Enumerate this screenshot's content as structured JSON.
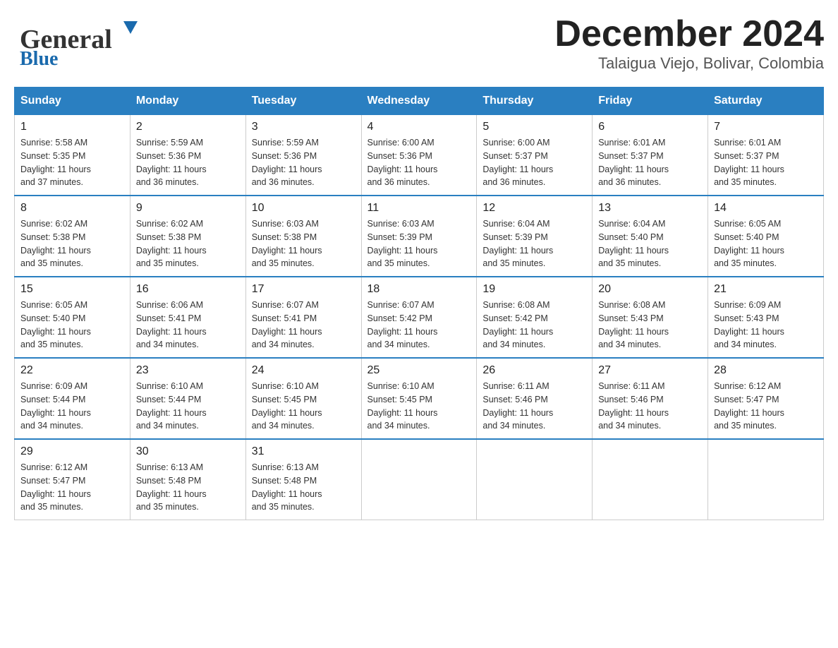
{
  "header": {
    "logo_general": "General",
    "logo_blue": "Blue",
    "month_title": "December 2024",
    "location": "Talaigua Viejo, Bolivar, Colombia"
  },
  "days_of_week": [
    "Sunday",
    "Monday",
    "Tuesday",
    "Wednesday",
    "Thursday",
    "Friday",
    "Saturday"
  ],
  "weeks": [
    [
      {
        "day": "1",
        "sunrise": "5:58 AM",
        "sunset": "5:35 PM",
        "daylight": "11 hours and 37 minutes."
      },
      {
        "day": "2",
        "sunrise": "5:59 AM",
        "sunset": "5:36 PM",
        "daylight": "11 hours and 36 minutes."
      },
      {
        "day": "3",
        "sunrise": "5:59 AM",
        "sunset": "5:36 PM",
        "daylight": "11 hours and 36 minutes."
      },
      {
        "day": "4",
        "sunrise": "6:00 AM",
        "sunset": "5:36 PM",
        "daylight": "11 hours and 36 minutes."
      },
      {
        "day": "5",
        "sunrise": "6:00 AM",
        "sunset": "5:37 PM",
        "daylight": "11 hours and 36 minutes."
      },
      {
        "day": "6",
        "sunrise": "6:01 AM",
        "sunset": "5:37 PM",
        "daylight": "11 hours and 36 minutes."
      },
      {
        "day": "7",
        "sunrise": "6:01 AM",
        "sunset": "5:37 PM",
        "daylight": "11 hours and 35 minutes."
      }
    ],
    [
      {
        "day": "8",
        "sunrise": "6:02 AM",
        "sunset": "5:38 PM",
        "daylight": "11 hours and 35 minutes."
      },
      {
        "day": "9",
        "sunrise": "6:02 AM",
        "sunset": "5:38 PM",
        "daylight": "11 hours and 35 minutes."
      },
      {
        "day": "10",
        "sunrise": "6:03 AM",
        "sunset": "5:38 PM",
        "daylight": "11 hours and 35 minutes."
      },
      {
        "day": "11",
        "sunrise": "6:03 AM",
        "sunset": "5:39 PM",
        "daylight": "11 hours and 35 minutes."
      },
      {
        "day": "12",
        "sunrise": "6:04 AM",
        "sunset": "5:39 PM",
        "daylight": "11 hours and 35 minutes."
      },
      {
        "day": "13",
        "sunrise": "6:04 AM",
        "sunset": "5:40 PM",
        "daylight": "11 hours and 35 minutes."
      },
      {
        "day": "14",
        "sunrise": "6:05 AM",
        "sunset": "5:40 PM",
        "daylight": "11 hours and 35 minutes."
      }
    ],
    [
      {
        "day": "15",
        "sunrise": "6:05 AM",
        "sunset": "5:40 PM",
        "daylight": "11 hours and 35 minutes."
      },
      {
        "day": "16",
        "sunrise": "6:06 AM",
        "sunset": "5:41 PM",
        "daylight": "11 hours and 34 minutes."
      },
      {
        "day": "17",
        "sunrise": "6:07 AM",
        "sunset": "5:41 PM",
        "daylight": "11 hours and 34 minutes."
      },
      {
        "day": "18",
        "sunrise": "6:07 AM",
        "sunset": "5:42 PM",
        "daylight": "11 hours and 34 minutes."
      },
      {
        "day": "19",
        "sunrise": "6:08 AM",
        "sunset": "5:42 PM",
        "daylight": "11 hours and 34 minutes."
      },
      {
        "day": "20",
        "sunrise": "6:08 AM",
        "sunset": "5:43 PM",
        "daylight": "11 hours and 34 minutes."
      },
      {
        "day": "21",
        "sunrise": "6:09 AM",
        "sunset": "5:43 PM",
        "daylight": "11 hours and 34 minutes."
      }
    ],
    [
      {
        "day": "22",
        "sunrise": "6:09 AM",
        "sunset": "5:44 PM",
        "daylight": "11 hours and 34 minutes."
      },
      {
        "day": "23",
        "sunrise": "6:10 AM",
        "sunset": "5:44 PM",
        "daylight": "11 hours and 34 minutes."
      },
      {
        "day": "24",
        "sunrise": "6:10 AM",
        "sunset": "5:45 PM",
        "daylight": "11 hours and 34 minutes."
      },
      {
        "day": "25",
        "sunrise": "6:10 AM",
        "sunset": "5:45 PM",
        "daylight": "11 hours and 34 minutes."
      },
      {
        "day": "26",
        "sunrise": "6:11 AM",
        "sunset": "5:46 PM",
        "daylight": "11 hours and 34 minutes."
      },
      {
        "day": "27",
        "sunrise": "6:11 AM",
        "sunset": "5:46 PM",
        "daylight": "11 hours and 34 minutes."
      },
      {
        "day": "28",
        "sunrise": "6:12 AM",
        "sunset": "5:47 PM",
        "daylight": "11 hours and 35 minutes."
      }
    ],
    [
      {
        "day": "29",
        "sunrise": "6:12 AM",
        "sunset": "5:47 PM",
        "daylight": "11 hours and 35 minutes."
      },
      {
        "day": "30",
        "sunrise": "6:13 AM",
        "sunset": "5:48 PM",
        "daylight": "11 hours and 35 minutes."
      },
      {
        "day": "31",
        "sunrise": "6:13 AM",
        "sunset": "5:48 PM",
        "daylight": "11 hours and 35 minutes."
      },
      null,
      null,
      null,
      null
    ]
  ],
  "labels": {
    "sunrise": "Sunrise:",
    "sunset": "Sunset:",
    "daylight": "Daylight:"
  }
}
